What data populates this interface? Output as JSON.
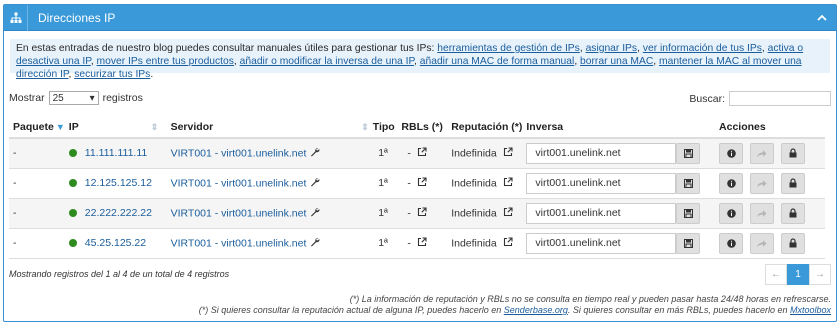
{
  "panel": {
    "title": "Direcciones IP"
  },
  "info": {
    "prefix": "En estas entradas de nuestro blog puedes consultar manuales útiles para gestionar tus IPs:",
    "links": [
      "herramientas de gestión de IPs",
      "asignar IPs",
      "ver información de tus IPs",
      "activa o desactiva una IP",
      "mover IPs entre tus productos",
      "añadir o modificar la inversa de una IP",
      "añadir una MAC de forma manual",
      "borrar una MAC",
      "mantener la MAC al mover una dirección IP",
      "securizar tus IPs"
    ]
  },
  "controls": {
    "show_label": "Mostrar",
    "show_value": "25",
    "records_label": "registros",
    "search_label": "Buscar:"
  },
  "table": {
    "headers": {
      "paquete": "Paquete",
      "ip": "IP",
      "servidor": "Servidor",
      "tipo": "Tipo",
      "rbls": "RBLs (*)",
      "reputacion": "Reputación (*)",
      "inversa": "Inversa",
      "acciones": "Acciones"
    },
    "rows": [
      {
        "paquete": "-",
        "ip": "11.111.111.11",
        "servidor": "VIRT001 - virt001.unelink.net",
        "tipo": "1ª",
        "rbls": "-",
        "reputacion": "Indefinida",
        "inversa": "virt001.unelink.net"
      },
      {
        "paquete": "-",
        "ip": "12.125.125.12",
        "servidor": "VIRT001 - virt001.unelink.net",
        "tipo": "1ª",
        "rbls": "-",
        "reputacion": "Indefinida",
        "inversa": "virt001.unelink.net"
      },
      {
        "paquete": "-",
        "ip": "22.222.222.22",
        "servidor": "VIRT001 - virt001.unelink.net",
        "tipo": "1ª",
        "rbls": "-",
        "reputacion": "Indefinida",
        "inversa": "virt001.unelink.net"
      },
      {
        "paquete": "-",
        "ip": "45.25.125.22",
        "servidor": "VIRT001 - virt001.unelink.net",
        "tipo": "1ª",
        "rbls": "-",
        "reputacion": "Indefinida",
        "inversa": "virt001.unelink.net"
      }
    ]
  },
  "footer": {
    "summary": "Mostrando registros del 1 al 4 de un total de 4 registros",
    "pager": {
      "prev": "←",
      "current": "1",
      "next": "→"
    }
  },
  "notes": {
    "line1": "(*) La información de reputación y RBLs no se consulta en tiempo real y pueden pasar hasta 24/48 horas en refrescarse.",
    "line2_a": "(*) Si quieres consultar la reputación actual de alguna IP, puedes hacerlo en ",
    "link1": "Senderbase.org",
    "line2_b": ". Si quieres consultar en más RBLs, puedes hacerlo en ",
    "link2": "Mxtoolbox"
  },
  "colors": {
    "accent": "#3a99d8",
    "status_ok": "#2e8b1e",
    "link": "#1a5d9c"
  },
  "icons": {
    "header": "sitemap-icon",
    "collapse": "chevron-up-icon",
    "save": "save-icon",
    "info": "info-icon",
    "move": "share-icon",
    "lock": "lock-icon",
    "tool": "wrench-icon",
    "external": "external-link-icon"
  }
}
